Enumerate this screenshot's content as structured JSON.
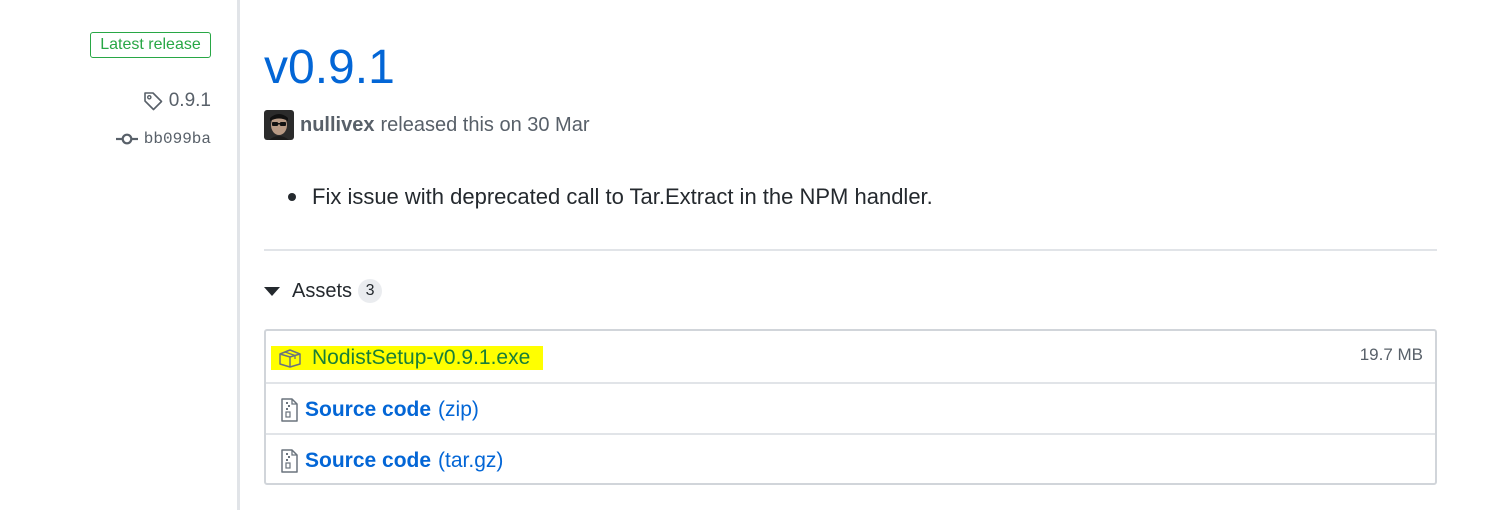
{
  "meta": {
    "latest_badge": "Latest release",
    "tag": "0.9.1",
    "commit": "bb099ba"
  },
  "release": {
    "title": "v0.9.1",
    "author": "nullivex",
    "released_text": "released this on 30 Mar",
    "notes": [
      "Fix issue with deprecated call to Tar.Extract in the NPM handler."
    ]
  },
  "assets": {
    "label": "Assets",
    "count": "3",
    "files": [
      {
        "name": "NodistSetup-v0.9.1.exe",
        "size": "19.7 MB",
        "icon": "package-icon"
      }
    ],
    "sources": [
      {
        "name": "Source code",
        "format": "(zip)",
        "icon": "file-zip-icon"
      },
      {
        "name": "Source code",
        "format": "(tar.gz)",
        "icon": "file-zip-icon"
      }
    ]
  },
  "colors": {
    "link": "#0366d6",
    "badge_green": "#28a745",
    "highlight": "#ffff00",
    "exe_text": "#1a7f37"
  }
}
